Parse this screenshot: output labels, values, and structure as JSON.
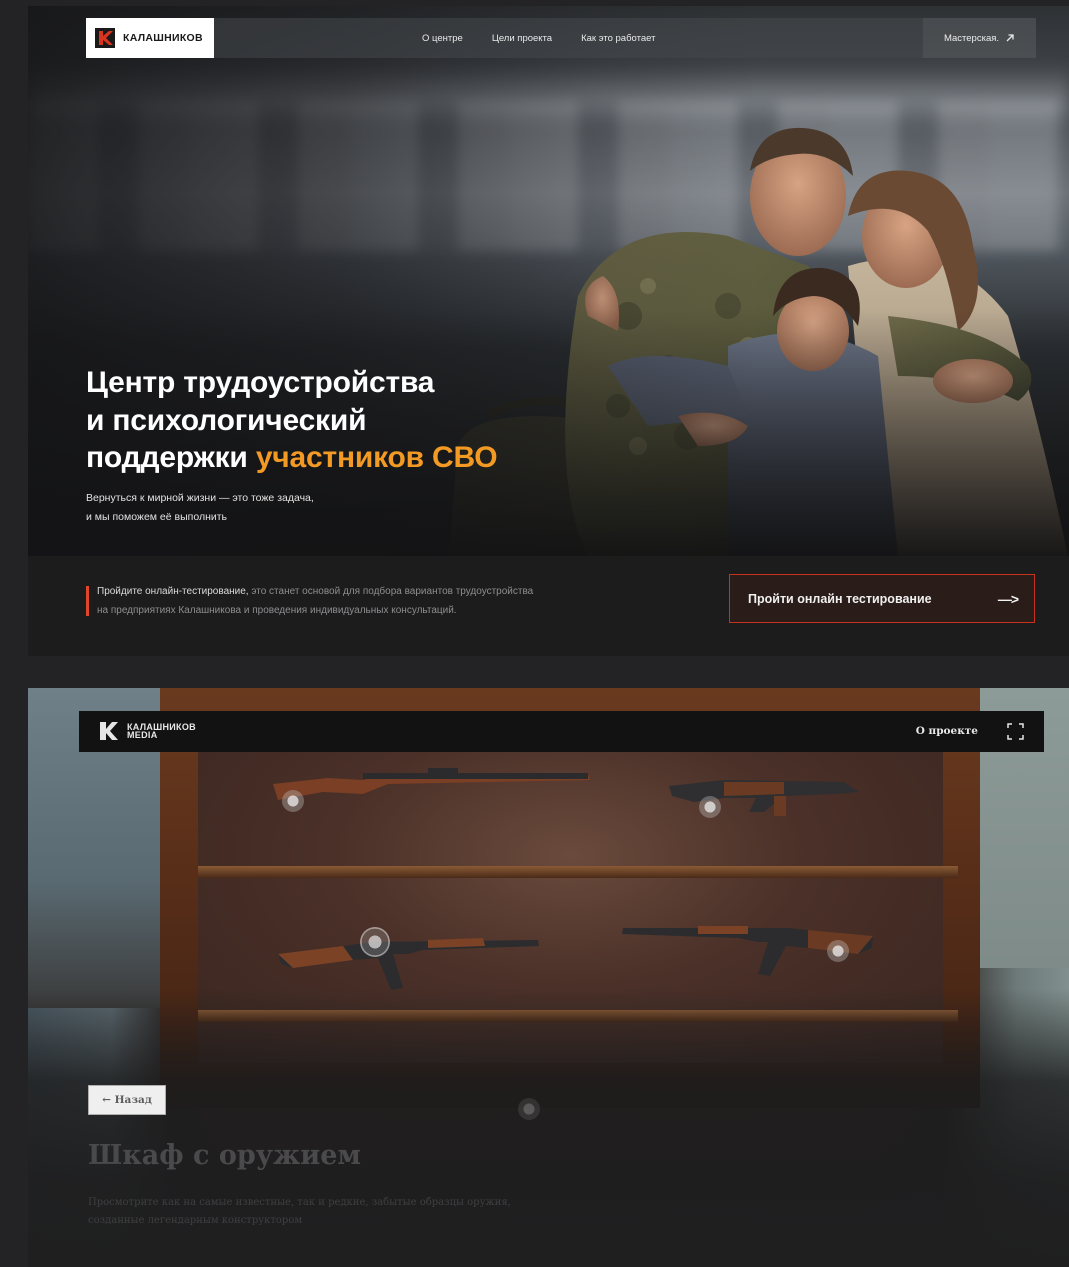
{
  "hero": {
    "logo_text": "КАЛАШНИКОВ",
    "nav": [
      {
        "label": "О центре"
      },
      {
        "label": "Цели проекта"
      },
      {
        "label": "Как это работает"
      }
    ],
    "nav_right_label": "Мастерская.",
    "title_line1": "Центр трудоустройства",
    "title_line2": "и психологический",
    "title_line3_plain": "поддержки ",
    "title_line3_accent": "участников СВО",
    "subtitle_line1": "Вернуться к мирной жизни — это тоже задача,",
    "subtitle_line2": "и мы поможем её выполнить",
    "cta_text_strong": "Пройдите онлайн-тестирование,",
    "cta_text_rest_line1": " это станет основой для подбора вариантов трудоустройства",
    "cta_text_line2": "на предприятиях Калашникова и проведения индивидуальных консультаций.",
    "cta_button_label": "Пройти онлайн тестирование",
    "cta_button_arrow": "—>"
  },
  "museum": {
    "logo_line1": "КАЛАШНИКОВ",
    "logo_line2": "MEDIA",
    "about_label": "О проекте",
    "back_label": "← Назад",
    "title": "Шкаф с оружием",
    "description_line1": "Просмотрите как на самые известные, так и редкие, забытые образцы оружия,",
    "description_line2": "созданные легендарным конструктором"
  },
  "colors": {
    "accent_orange": "#f29a24",
    "cta_red": "#c6321e",
    "logo_red": "#d8341f"
  },
  "icons": {
    "nav_right": "arrow-up-right-icon",
    "fullscreen": "fullscreen-icon",
    "logo": "kalashnikov-k-logo"
  }
}
